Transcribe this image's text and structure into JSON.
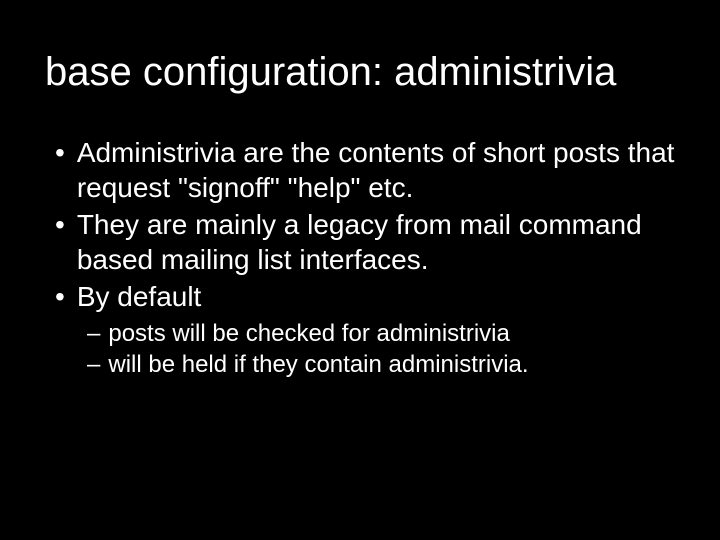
{
  "slide": {
    "title": "base configuration: administrivia",
    "bullets": [
      {
        "text": "Administrivia are the contents of short posts that request \"signoff\" \"help\" etc."
      },
      {
        "text": "They are mainly a legacy from mail command based mailing list interfaces."
      },
      {
        "text": "By default"
      }
    ],
    "subBullets": [
      {
        "text": "posts will be checked for administrivia"
      },
      {
        "text": "will be held if they contain administrivia."
      }
    ]
  }
}
